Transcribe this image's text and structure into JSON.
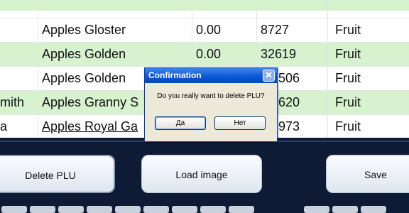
{
  "table": {
    "rows": [
      {
        "prefix": "",
        "name": "Apples Gloster",
        "price": "0.00",
        "plu": "8727",
        "category": "Fruit"
      },
      {
        "prefix": "",
        "name": "Apples Golden",
        "price": "0.00",
        "plu": "32619",
        "category": "Fruit"
      },
      {
        "prefix": "",
        "name": "Apples Golden",
        "price": "",
        "plu": "506",
        "category": "Fruit"
      },
      {
        "prefix": "mith",
        "name": "Apples Granny S",
        "price": "",
        "plu": "620",
        "category": "Fruit"
      },
      {
        "prefix": "a",
        "name": "Apples Royal Ga",
        "price": "",
        "plu": "973",
        "category": "Fruit"
      }
    ]
  },
  "dialog": {
    "title": "Confirmation",
    "message": "Do you really want to delete PLU?",
    "yes_label": "Да",
    "no_label": "Нет"
  },
  "buttons": {
    "delete_label": "Delete PLU",
    "load_label": "Load image",
    "save_label": "Save"
  },
  "icons": {
    "close": "close-icon"
  },
  "colors": {
    "row_green": "#d7f2cf",
    "panel_bg": "#0f1a35",
    "titlebar": "#0a55d6"
  }
}
